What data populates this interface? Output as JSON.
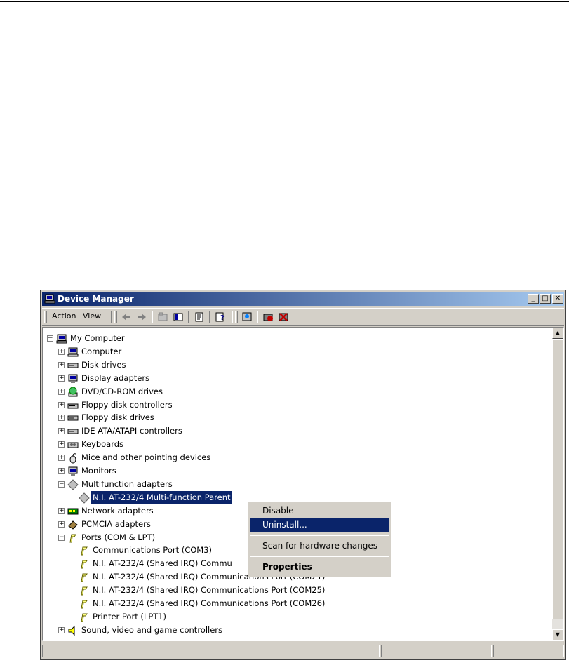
{
  "window": {
    "title": "Device Manager"
  },
  "menu": {
    "action": "Action",
    "view": "View"
  },
  "tree": {
    "root": "My Computer",
    "items": [
      "Computer",
      "Disk drives",
      "Display adapters",
      "DVD/CD-ROM drives",
      "Floppy disk controllers",
      "Floppy disk drives",
      "IDE ATA/ATAPI controllers",
      "Keyboards",
      "Mice and other pointing devices",
      "Monitors",
      "Multifunction adapters"
    ],
    "multifunction_child": "N.I. AT-232/4 Multi-function Parent",
    "after_items": [
      "Network adapters",
      "PCMCIA adapters",
      "Ports (COM & LPT)"
    ],
    "ports": [
      "Communications Port (COM3)",
      "N.I. AT-232/4 (Shared IRQ) Commu",
      "N.I. AT-232/4 (Shared IRQ) Communications Port (COM21)",
      "N.I. AT-232/4 (Shared IRQ) Communications Port (COM25)",
      "N.I. AT-232/4 (Shared IRQ) Communications Port (COM26)",
      "Printer Port (LPT1)"
    ],
    "last": "Sound, video and game controllers"
  },
  "context_menu": {
    "disable": "Disable",
    "uninstall": "Uninstall...",
    "scan": "Scan for hardware changes",
    "properties": "Properties"
  },
  "icons": {
    "title": "computer-manager-icon",
    "back": "back-arrow-icon",
    "forward": "forward-arrow-icon",
    "up": "up-folder-icon",
    "show_hide": "show-hide-tree-icon",
    "properties": "properties-icon",
    "help": "help-icon",
    "scan": "scan-hardware-icon",
    "disable": "disable-device-icon",
    "uninstall": "uninstall-device-icon"
  },
  "colors": {
    "selection": "#0a246a",
    "face": "#d4d0c8"
  }
}
